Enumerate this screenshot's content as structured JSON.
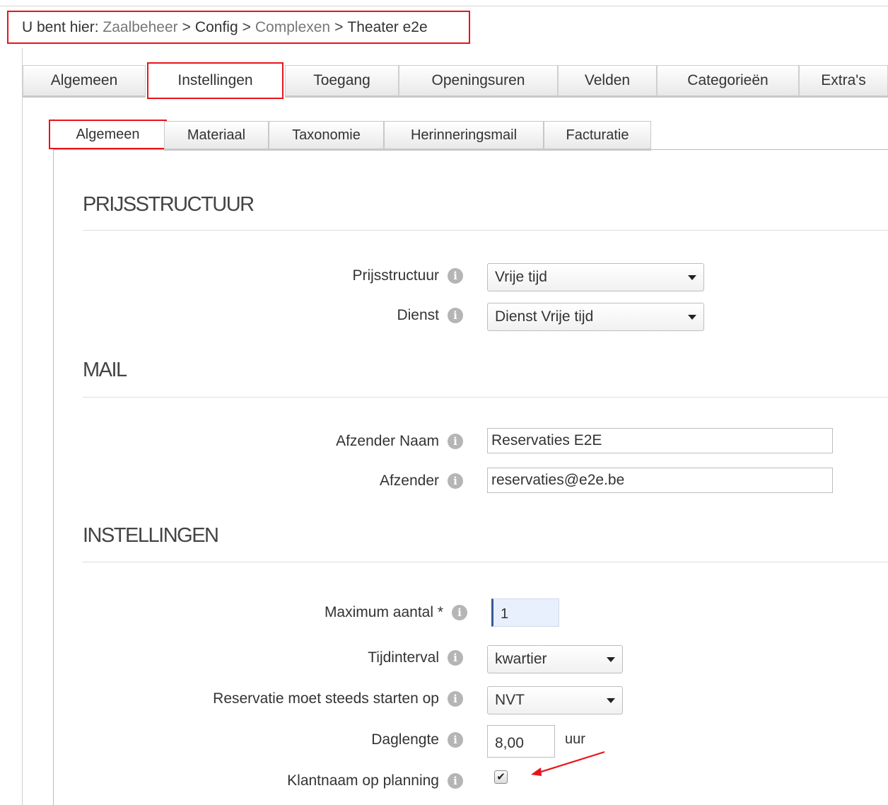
{
  "breadcrumb": {
    "prefix": "U bent hier:",
    "items": [
      "Zaalbeheer",
      "Config",
      "Complexen",
      "Theater e2e"
    ],
    "separator": ">"
  },
  "main_tabs": [
    {
      "label": "Algemeen",
      "active": false
    },
    {
      "label": "Instellingen",
      "active": true
    },
    {
      "label": "Toegang",
      "active": false
    },
    {
      "label": "Openingsuren",
      "active": false
    },
    {
      "label": "Velden",
      "active": false
    },
    {
      "label": "Categorieën",
      "active": false
    },
    {
      "label": "Extra's",
      "active": false
    }
  ],
  "sub_tabs": [
    {
      "label": "Algemeen",
      "active": true
    },
    {
      "label": "Materiaal",
      "active": false
    },
    {
      "label": "Taxonomie",
      "active": false
    },
    {
      "label": "Herinneringsmail",
      "active": false
    },
    {
      "label": "Facturatie",
      "active": false
    }
  ],
  "sections": {
    "prijsstructuur": {
      "title": "PRIJSSTRUCTUUR",
      "prijsstructuur_label": "Prijsstructuur",
      "prijsstructuur_value": "Vrije tijd",
      "dienst_label": "Dienst",
      "dienst_value": "Dienst Vrije tijd"
    },
    "mail": {
      "title": "MAIL",
      "afzender_naam_label": "Afzender Naam",
      "afzender_naam_value": "Reservaties E2E",
      "afzender_label": "Afzender",
      "afzender_value": "reservaties@e2e.be"
    },
    "instellingen": {
      "title": "INSTELLINGEN",
      "maximum_aantal_label": "Maximum aantal *",
      "maximum_aantal_value": "1",
      "tijdinterval_label": "Tijdinterval",
      "tijdinterval_value": "kwartier",
      "start_label": "Reservatie moet steeds starten op",
      "start_value": "NVT",
      "daglengte_label": "Daglengte",
      "daglengte_value": "8,00",
      "daglengte_unit": "uur",
      "klantnaam_label": "Klantnaam op planning",
      "klantnaam_checked": true
    }
  },
  "info_icon_glyph": "i",
  "checkmark_glyph": "✔",
  "colors": {
    "highlight_red": "#e8141b",
    "focus_input_bg": "#e8f0fe",
    "info_icon": "#b5b5b5"
  }
}
